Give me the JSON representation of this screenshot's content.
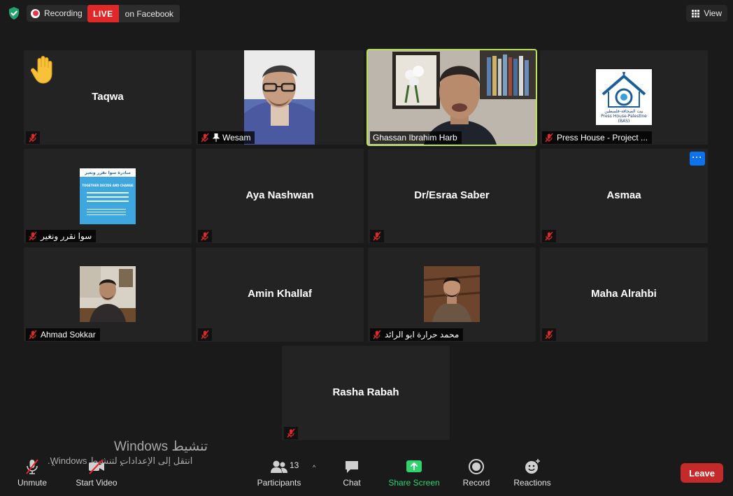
{
  "top": {
    "recording_label": "Recording",
    "live_badge": "LIVE",
    "live_target": "on Facebook",
    "view_label": "View"
  },
  "tiles": [
    {
      "name": "Taqwa",
      "raised_hand": true
    },
    {
      "name": "Wesam",
      "pinned": true
    },
    {
      "name": "Ghassan Ibrahim Harb",
      "active_speaker": true
    },
    {
      "name": "Press House - Project ...",
      "logo_text": "بيت الصحافة-فلسطين",
      "logo_sub": "Press House-Palestine",
      "logo_sub2": "(BAS)"
    },
    {
      "name": "سوا نقرر ونغير",
      "poster_title": "مبادرة سوا نقرر ونغير",
      "poster_sub": "TOGETHER DECIDE AND CHANGE"
    },
    {
      "name": "Aya Nashwan"
    },
    {
      "name": "Dr/Esraa Saber"
    },
    {
      "name": "Asmaa",
      "more_label": "···"
    },
    {
      "name": "Ahmad Sokkar"
    },
    {
      "name": "Amin Khallaf"
    },
    {
      "name": "محمد حرارة ابو الرائد"
    },
    {
      "name": "Maha Alrahbi"
    },
    {
      "name": "Rasha Rabah"
    }
  ],
  "watermark": {
    "line1": "تنشيط Windows",
    "line2": "انتقل إلى الإعدادات لتنشيط Windows."
  },
  "toolbar": {
    "unmute": "Unmute",
    "start_video": "Start Video",
    "participants": "Participants",
    "participants_count": "13",
    "chat": "Chat",
    "share_screen": "Share Screen",
    "record": "Record",
    "reactions": "Reactions",
    "leave": "Leave"
  },
  "colors": {
    "active_speaker_border": "#b9e25b",
    "live_red": "#e02828",
    "share_green": "#2dd36f",
    "leave_red": "#c52a2a",
    "more_blue": "#0e72ed"
  }
}
